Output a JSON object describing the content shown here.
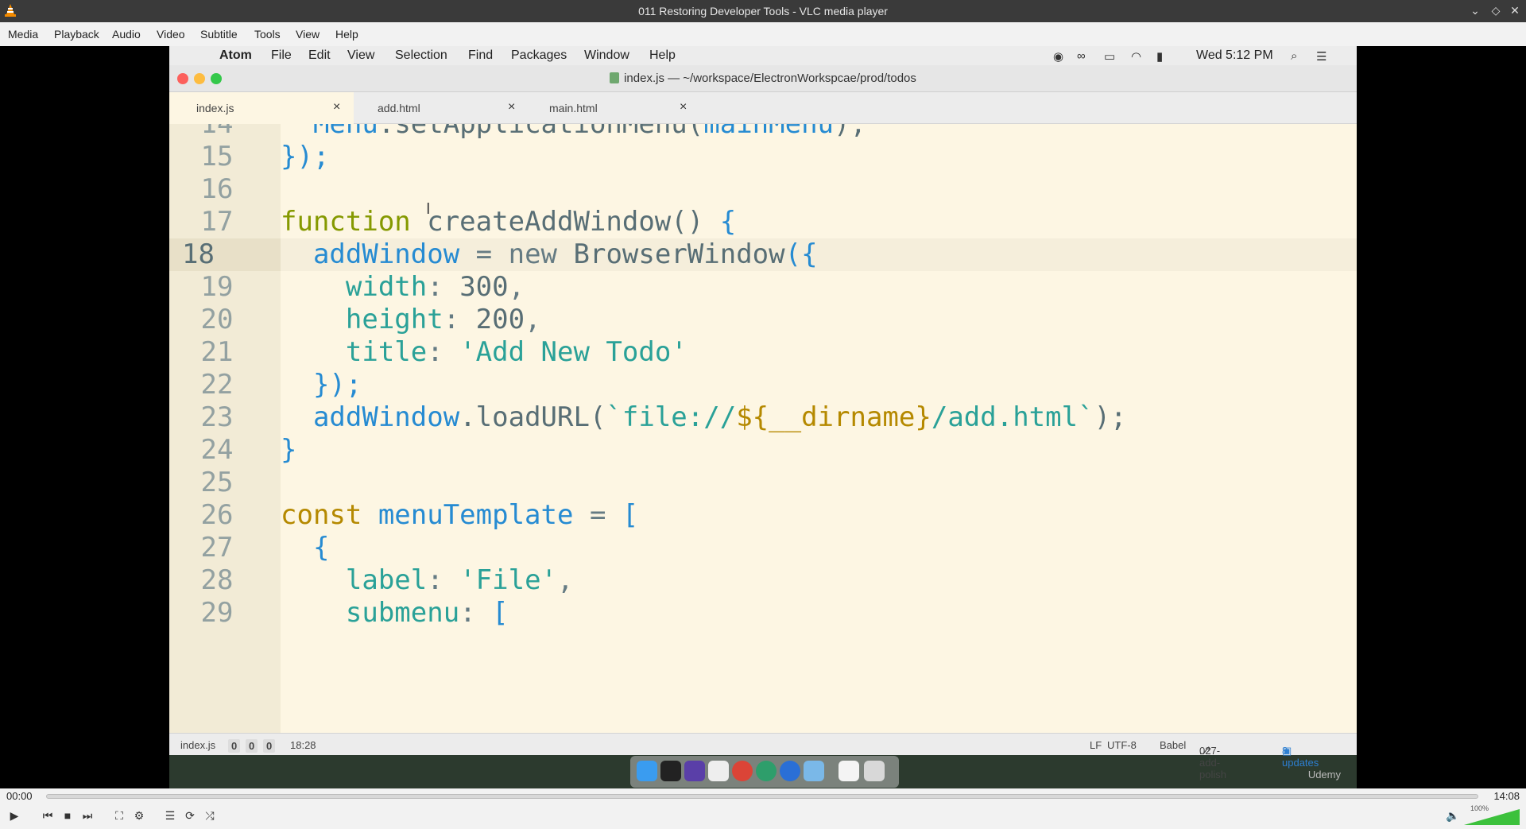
{
  "vlc": {
    "title": "011 Restoring Developer Tools - VLC media player",
    "menu": [
      "Media",
      "Playback",
      "Audio",
      "Video",
      "Subtitle",
      "Tools",
      "View",
      "Help"
    ],
    "time_current": "00:00",
    "time_total": "14:08",
    "progress": 0.0,
    "volume_label": "100%",
    "volume": 1.0
  },
  "mac": {
    "app": "Atom",
    "menu": [
      "File",
      "Edit",
      "View",
      "Selection",
      "Find",
      "Packages",
      "Window",
      "Help"
    ],
    "clock": "Wed 5:12 PM"
  },
  "atom": {
    "window_title": "index.js — ~/workspace/ElectronWorkspcae/prod/todos",
    "tabs": [
      {
        "label": "index.js",
        "active": true
      },
      {
        "label": "add.html",
        "active": false
      },
      {
        "label": "main.html",
        "active": false
      }
    ],
    "lines": [
      {
        "num": "14",
        "parts": [
          [
            "  ",
            "o"
          ],
          [
            "Menu",
            "v"
          ],
          [
            ".setApplicationMenu(",
            "f"
          ],
          [
            "mainMenu",
            "v"
          ],
          [
            ");",
            "f"
          ]
        ]
      },
      {
        "num": "15",
        "parts": [
          [
            "});",
            "p"
          ]
        ]
      },
      {
        "num": "16",
        "parts": []
      },
      {
        "num": "17",
        "parts": [
          [
            "function ",
            "k"
          ],
          [
            "createAddWindow",
            "f"
          ],
          [
            "() ",
            "f"
          ],
          [
            "{",
            "p"
          ]
        ]
      },
      {
        "num": "18",
        "parts": [
          [
            "  ",
            "o"
          ],
          [
            "addWindow",
            "v"
          ],
          [
            " = ",
            "o"
          ],
          [
            "new ",
            "o"
          ],
          [
            "BrowserWindow",
            "f"
          ],
          [
            "({",
            "p"
          ]
        ],
        "current": true
      },
      {
        "num": "19",
        "parts": [
          [
            "    ",
            "o"
          ],
          [
            "width",
            "s"
          ],
          [
            ": ",
            "o"
          ],
          [
            "300",
            "f"
          ],
          [
            ",",
            "o"
          ]
        ]
      },
      {
        "num": "20",
        "parts": [
          [
            "    ",
            "o"
          ],
          [
            "height",
            "s"
          ],
          [
            ": ",
            "o"
          ],
          [
            "200",
            "f"
          ],
          [
            ",",
            "o"
          ]
        ]
      },
      {
        "num": "21",
        "parts": [
          [
            "    ",
            "o"
          ],
          [
            "title",
            "s"
          ],
          [
            ": ",
            "o"
          ],
          [
            "'Add New Todo'",
            "s"
          ]
        ]
      },
      {
        "num": "22",
        "parts": [
          [
            "  ",
            "o"
          ],
          [
            "});",
            "p"
          ]
        ]
      },
      {
        "num": "23",
        "parts": [
          [
            "  ",
            "o"
          ],
          [
            "addWindow",
            "v"
          ],
          [
            ".loadURL(",
            "f"
          ],
          [
            "`file://",
            "s"
          ],
          [
            "${",
            "y"
          ],
          [
            "__dirname",
            "y"
          ],
          [
            "}",
            "y"
          ],
          [
            "/add.html`",
            "s"
          ],
          [
            ");",
            "f"
          ]
        ]
      },
      {
        "num": "24",
        "parts": [
          [
            "}",
            "p"
          ]
        ]
      },
      {
        "num": "25",
        "parts": []
      },
      {
        "num": "26",
        "parts": [
          [
            "const ",
            "y"
          ],
          [
            "menuTemplate",
            "v"
          ],
          [
            " = ",
            "o"
          ],
          [
            "[",
            "p"
          ]
        ]
      },
      {
        "num": "27",
        "parts": [
          [
            "  ",
            "o"
          ],
          [
            "{",
            "p"
          ]
        ]
      },
      {
        "num": "28",
        "parts": [
          [
            "    ",
            "o"
          ],
          [
            "label",
            "s"
          ],
          [
            ": ",
            "o"
          ],
          [
            "'File'",
            "s"
          ],
          [
            ",",
            "o"
          ]
        ]
      },
      {
        "num": "29",
        "parts": [
          [
            "    ",
            "o"
          ],
          [
            "submenu",
            "s"
          ],
          [
            ": ",
            "o"
          ],
          [
            "[",
            "p"
          ]
        ]
      }
    ],
    "status": {
      "file": "index.js",
      "counts": [
        "0",
        "0",
        "0"
      ],
      "cursor": "18:28",
      "eol": "LF",
      "encoding": "UTF-8",
      "grammar": "Babel",
      "branch": "027-add-polish",
      "updates": "8 updates"
    }
  },
  "watermark": "Udemy"
}
